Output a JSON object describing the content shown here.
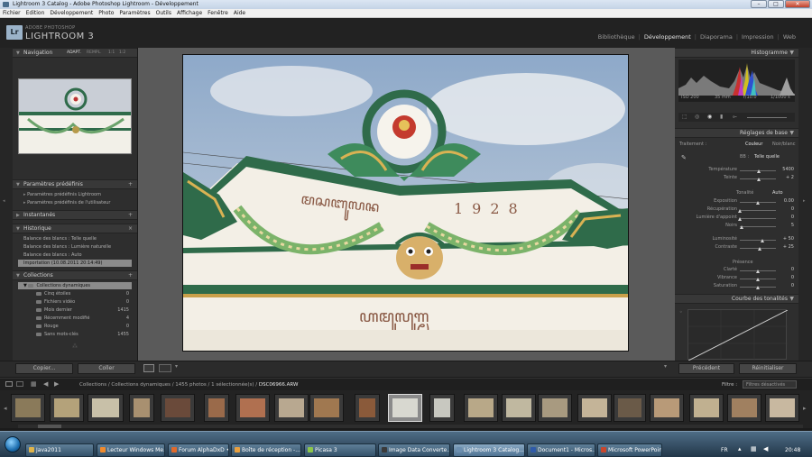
{
  "window": {
    "title": "Lightroom 3 Catalog - Adobe Photoshop Lightroom - Développement",
    "minimize": "–",
    "maximize": "□",
    "close": "✕"
  },
  "menu": [
    "Fichier",
    "Edition",
    "Développement",
    "Photo",
    "Paramètres",
    "Outils",
    "Affichage",
    "Fenêtre",
    "Aide"
  ],
  "brand": {
    "line1": "ADOBE PHOTOSHOP",
    "line2": "LIGHTROOM 3",
    "logo": "Lr"
  },
  "modules": {
    "items": [
      "Bibliothèque",
      "Développement",
      "Diaporama",
      "Impression",
      "Web"
    ],
    "active": "Développement",
    "separator": "|"
  },
  "left": {
    "navigator": {
      "title": "Navigation",
      "options": [
        "ADAPT.",
        "REMPL.",
        "1:1",
        "1:2"
      ]
    },
    "presets": {
      "title": "Paramètres prédéfinis",
      "items": [
        "Paramètres prédéfinis Lightroom",
        "Paramètres prédéfinis de l'utilisateur"
      ]
    },
    "snapshots": {
      "title": "Instantanés"
    },
    "history": {
      "title": "Historique",
      "close": "×",
      "items": [
        "Balance des blancs : Telle quelle",
        "Balance des blancs : Lumière naturelle",
        "Balance des blancs : Auto",
        "Importation (10.08.2011 20:14:49)"
      ]
    },
    "collections": {
      "title": "Collections",
      "group": "Collections dynamiques",
      "items": [
        {
          "name": "Cinq étoiles",
          "count": "0"
        },
        {
          "name": "Fichiers vidéo",
          "count": "0"
        },
        {
          "name": "Mois dernier",
          "count": "1415"
        },
        {
          "name": "Récemment modifié",
          "count": "4"
        },
        {
          "name": "Rouge",
          "count": "0"
        },
        {
          "name": "Sans mots-clés",
          "count": "1455"
        }
      ]
    },
    "copy_label": "Copier...",
    "paste_label": "Coller"
  },
  "right": {
    "histogram": {
      "title": "Histogramme",
      "iso": "ISO 200",
      "focal": "35 mm",
      "aperture": "f/10.0",
      "shutter": "1/1000 s"
    },
    "basic": {
      "title": "Réglages de base",
      "treatment_label": "Traitement :",
      "color": "Couleur",
      "bw": "Noir/blanc",
      "wb_label": "BB :",
      "wb_value": "Telle quelle",
      "tone_title": "Tonalité",
      "auto": "Auto",
      "presence_title": "Présence"
    },
    "sliders_wb": [
      {
        "label": "Température",
        "value": "5400",
        "pos": 0.52
      },
      {
        "label": "Teinte",
        "value": "+ 2",
        "pos": 0.53
      }
    ],
    "sliders_tone": [
      {
        "label": "Exposition",
        "value": "0.00",
        "pos": 0.5
      },
      {
        "label": "Récupération",
        "value": "0",
        "pos": 0.0
      },
      {
        "label": "Lumière d'appoint",
        "value": "0",
        "pos": 0.0
      },
      {
        "label": "Noirs",
        "value": "5",
        "pos": 0.05
      }
    ],
    "sliders_bc": [
      {
        "label": "Luminosité",
        "value": "+ 50",
        "pos": 0.62
      },
      {
        "label": "Contraste",
        "value": "+ 25",
        "pos": 0.56
      }
    ],
    "sliders_presence": [
      {
        "label": "Clarté",
        "value": "0",
        "pos": 0.5
      },
      {
        "label": "Vibrance",
        "value": "0",
        "pos": 0.5
      },
      {
        "label": "Saturation",
        "value": "0",
        "pos": 0.5
      }
    ],
    "tone_curve": {
      "title": "Courbe des tonalités"
    },
    "previous_label": "Précédent",
    "reset_label": "Réinitialiser"
  },
  "filmstrip": {
    "path_prefix": "Collections / Collections dynamiques / 1455 photos / 1 sélectionnée(s) / ",
    "filename": "DSC06966.ARW",
    "filter_label": "Filtre :",
    "filter_value": "Filtres désactivés"
  },
  "taskbar": {
    "items": [
      {
        "label": "Java2011",
        "color": "#e0b44a"
      },
      {
        "label": "Lecteur Windows Me...",
        "color": "#f08a2c"
      },
      {
        "label": "Forum AlphaDxD • P...",
        "color": "#e06a2c"
      },
      {
        "label": "Boîte de réception -...",
        "color": "#e8a040"
      },
      {
        "label": "Picasa 3",
        "color": "#8cc64a"
      },
      {
        "label": "Image Data Converte...",
        "color": "#3a3a3a"
      },
      {
        "label": "Lightroom 3 Catalog...",
        "color": "#6c8fb0"
      },
      {
        "label": "Document1 - Micros...",
        "color": "#2f5aa8"
      },
      {
        "label": "Microsoft PowerPoin...",
        "color": "#c8462c"
      }
    ],
    "active": "Lightroom 3 Catalog...",
    "language": "FR",
    "clock": "20:48"
  },
  "colors": {
    "panel": "#2e2e2e",
    "header": "#383838",
    "center": "#5a5a5a",
    "selected": "#8b8b8b"
  }
}
